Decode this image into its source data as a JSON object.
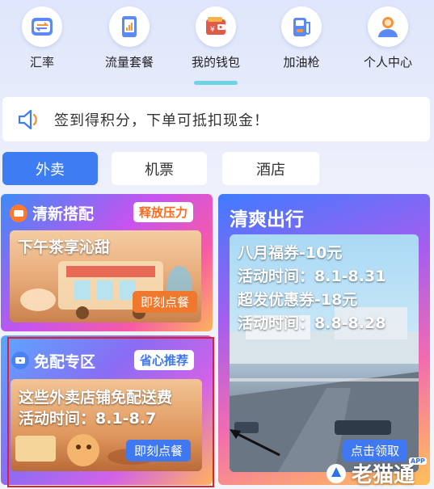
{
  "nav": {
    "items": [
      {
        "label": "汇率",
        "icon": "exchange-icon"
      },
      {
        "label": "流量套餐",
        "icon": "data-plan-icon"
      },
      {
        "label": "我的钱包",
        "icon": "wallet-icon"
      },
      {
        "label": "加油枪",
        "icon": "fuel-pump-icon"
      },
      {
        "label": "个人中心",
        "icon": "profile-icon"
      }
    ],
    "active_index": 2
  },
  "notice": {
    "icon": "speaker-icon",
    "text": "签到得积分，下单可抵扣现金！"
  },
  "tabs": [
    {
      "label": "外卖",
      "active": true
    },
    {
      "label": "机票",
      "active": false
    },
    {
      "label": "酒店",
      "active": false
    }
  ],
  "cards": {
    "fresh": {
      "title": "清新搭配",
      "badge": "释放压力",
      "subtitle": "下午茶享沁甜",
      "cta": "即刻点餐"
    },
    "free_delivery": {
      "title": "免配专区",
      "badge": "省心推荐",
      "line1": "这些外卖店铺免配送费",
      "line2": "活动时间：8.1-8.7",
      "cta": "即刻点餐"
    },
    "travel": {
      "title": "清爽出行",
      "line1": "八月福券-10元",
      "line2": "活动时间：8.1-8.31",
      "line3": "超发优惠券-18元",
      "line4": "活动时间：8.8-8.28",
      "cta": "点击领取"
    }
  },
  "watermark": {
    "text": "老猫通",
    "app": "APP"
  },
  "colors": {
    "accent": "#3d7cf3",
    "cta_orange": "#f0782c",
    "cta_blue": "#3f78f0",
    "highlight": "#e21f2a"
  }
}
